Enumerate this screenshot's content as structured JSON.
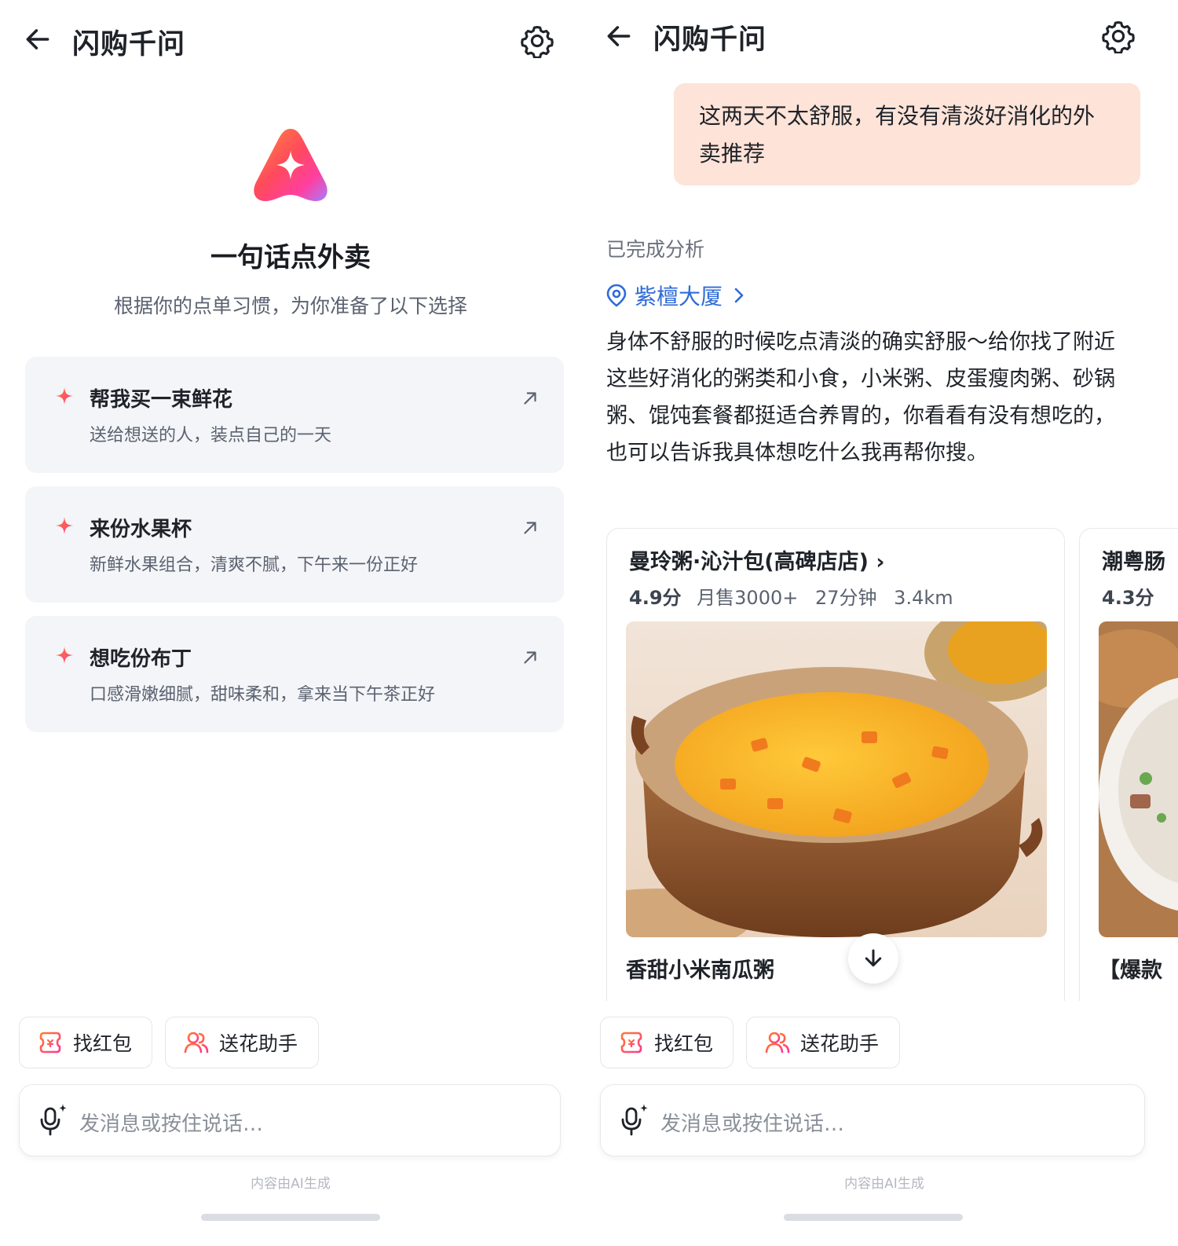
{
  "left": {
    "header": {
      "title": "闪购千问",
      "back_icon": "back-arrow-icon",
      "settings_icon": "gear-icon"
    },
    "hero": {
      "logo_icon": "qianwen-logo-icon",
      "title": "一句话点外卖",
      "subtitle": "根据你的点单习惯，为你准备了以下选择"
    },
    "suggestions": [
      {
        "title": "帮我买一束鲜花",
        "desc": "送给想送的人，装点自己的一天"
      },
      {
        "title": "来份水果杯",
        "desc": "新鲜水果组合，清爽不腻，下午来一份正好"
      },
      {
        "title": "想吃份布丁",
        "desc": "口感滑嫩细腻，甜味柔和，拿来当下午茶正好"
      }
    ],
    "quick_actions": [
      {
        "label": "找红包",
        "icon": "red-packet-icon"
      },
      {
        "label": "送花助手",
        "icon": "users-icon"
      }
    ],
    "input": {
      "placeholder": "发消息或按住说话…"
    },
    "ai_note": "内容由AI生成"
  },
  "right": {
    "header": {
      "title": "闪购千问",
      "back_icon": "back-arrow-icon",
      "settings_icon": "gear-icon"
    },
    "user_message": "这两天不太舒服，有没有清淡好消化的外卖推荐",
    "status": "已完成分析",
    "location": {
      "label": "紫檀大厦",
      "icon": "location-pin-icon"
    },
    "reply": "身体不舒服的时候吃点清淡的确实舒服～给你找了附近这些好消化的粥类和小食，小米粥、皮蛋瘦肉粥、砂锅粥、馄饨套餐都挺适合养胃的，你看看有没有想吃的，也可以告诉我具体想吃什么我再帮你搜。",
    "stores": [
      {
        "name": "曼玲粥·沁汁包(高碑店店)",
        "chevron": "›",
        "rating": "4.9分",
        "sales": "月售3000+",
        "time": "27分钟",
        "distance": "3.4km",
        "dish": "香甜小米南瓜粥"
      },
      {
        "name": "潮粤肠",
        "rating": "4.3分",
        "dish": "【爆款"
      }
    ],
    "quick_actions": [
      {
        "label": "找红包",
        "icon": "red-packet-icon"
      },
      {
        "label": "送花助手",
        "icon": "users-icon"
      }
    ],
    "input": {
      "placeholder": "发消息或按住说话…"
    },
    "ai_note": "内容由AI生成"
  },
  "colors": {
    "accent_blue": "#2f6bd8",
    "bubble_bg": "#fde3d8",
    "card_bg": "#f3f5f8",
    "icon_gradient_start": "#ff6a3d",
    "icon_gradient_end": "#b06cff"
  }
}
